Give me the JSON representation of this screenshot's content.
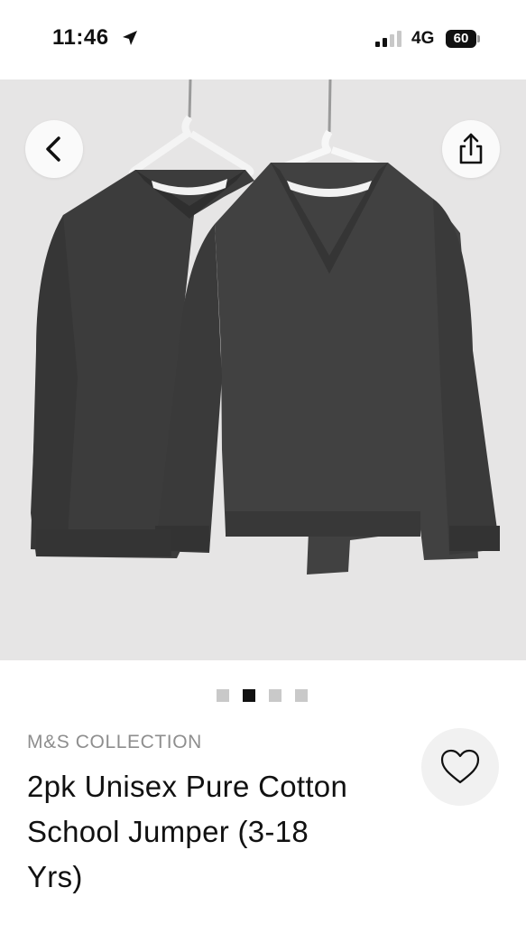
{
  "status_bar": {
    "time": "11:46",
    "network": "4G",
    "battery": "60"
  },
  "gallery": {
    "image_count": 4,
    "active_index": 1,
    "icons": [
      "chevron-left-icon",
      "share-icon",
      "location-arrow-icon",
      "signal-icon"
    ]
  },
  "product": {
    "brand": "M&S COLLECTION",
    "title": "2pk Unisex Pure Cotton School Jumper (3-18 Yrs)"
  },
  "colors": {
    "gallery_bg": "#e6e5e5",
    "jumper": "#3a3a3a",
    "dot_active": "#111111",
    "dot_inactive": "#c9c9c9",
    "brand_text": "#8e8e8e"
  }
}
